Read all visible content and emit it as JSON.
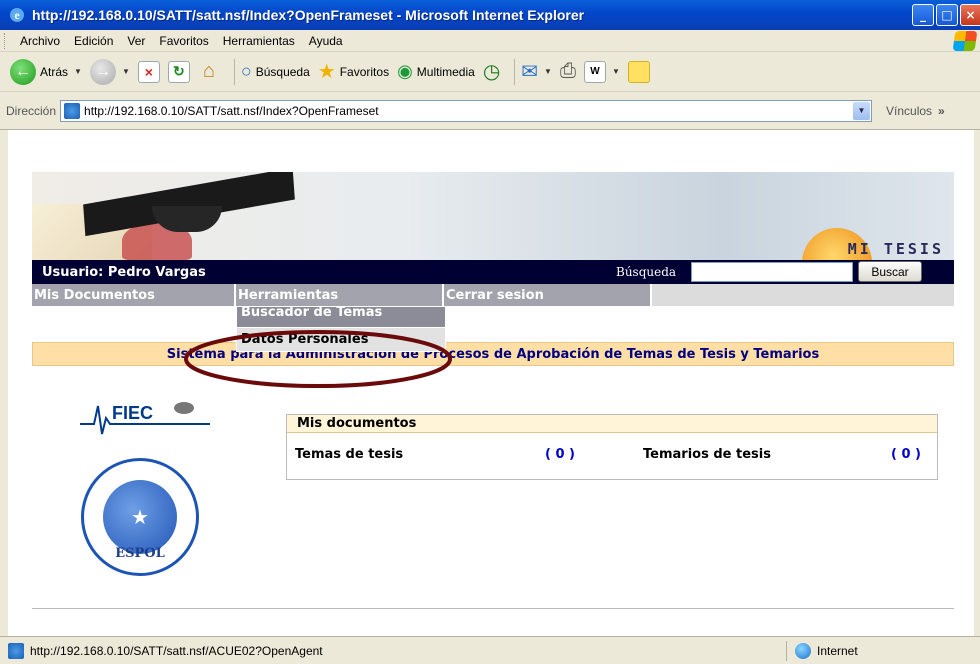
{
  "window": {
    "title": "http://192.168.0.10/SATT/satt.nsf/Index?OpenFrameset - Microsoft Internet Explorer"
  },
  "menu": [
    "Archivo",
    "Edición",
    "Ver",
    "Favoritos",
    "Herramientas",
    "Ayuda"
  ],
  "toolbar": {
    "back": "Atrás",
    "search": "Búsqueda",
    "favorites": "Favoritos",
    "media": "Multimedia"
  },
  "address": {
    "label": "Dirección",
    "url": "http://192.168.0.10/SATT/satt.nsf/Index?OpenFrameset",
    "links": "Vínculos"
  },
  "page": {
    "banner_text": "MI TESIS",
    "user": "Usuario: Pedro Vargas",
    "search_label": "Búsqueda",
    "search_value": "",
    "search_button": "Buscar",
    "nav": [
      "Mis Documentos",
      "Herramientas",
      "Cerrar sesion"
    ],
    "dropdown": [
      "Buscador de Temas",
      "Datos Personales"
    ],
    "system_title": "Sistema para la Administración de Procesos de Aprobación de Temas de Tesis y Temarios",
    "fiec_logo": "FIEC",
    "espol_logo": "ESPOL",
    "docs": {
      "header": "Mis documentos",
      "temas_label": "Temas de tesis",
      "temas_count": "( 0 )",
      "temarios_label": "Temarios de tesis",
      "temarios_count": "( 0 )"
    }
  },
  "status": {
    "text": "http://192.168.0.10/SATT/satt.nsf/ACUE02?OpenAgent",
    "zone": "Internet"
  },
  "annotation_color": "#6b0a0a"
}
